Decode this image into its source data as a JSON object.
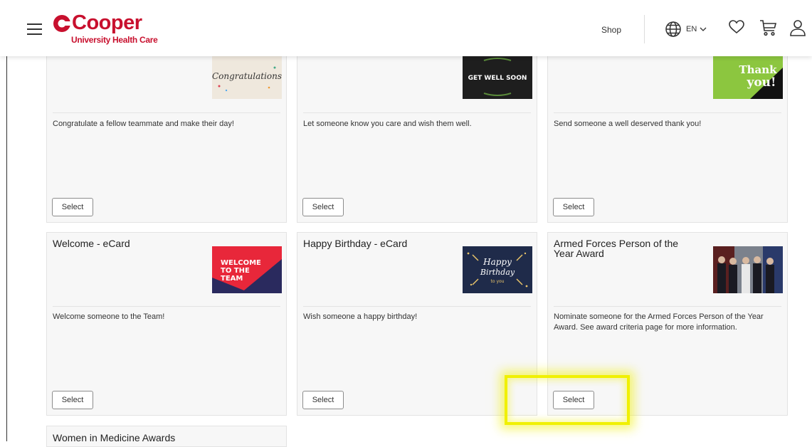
{
  "header": {
    "logo_word": "Cooper",
    "logo_sub": "University Health Care",
    "shop_label": "Shop",
    "lang_label": "EN"
  },
  "colors": {
    "brand": "#c8102e",
    "highlight": "#f0f000"
  },
  "cards": [
    {
      "title": "",
      "description": "Congratulate a fellow teammate and make their day!",
      "button": "Select",
      "image_text": "Congratulations"
    },
    {
      "title": "",
      "description": "Let someone know you care and wish them well.",
      "button": "Select",
      "image_text": "GET WELL SOON"
    },
    {
      "title": "",
      "description": "Send someone a well deserved thank you!",
      "button": "Select",
      "image_text_1": "Thank",
      "image_text_2": "you!"
    },
    {
      "title": "Welcome - eCard",
      "description": "Welcome someone to the Team!",
      "button": "Select",
      "image_text_1": "WELCOME",
      "image_text_2": "TO THE",
      "image_text_3": "TEAM"
    },
    {
      "title": "Happy Birthday - eCard",
      "description": "Wish someone a happy birthday!",
      "button": "Select",
      "image_text_1": "Happy",
      "image_text_2": "Birthday",
      "image_text_3": "to you"
    },
    {
      "title": "Armed Forces Person of the Year Award",
      "description": "Nominate someone for the Armed Forces Person of the Year Award. See award criteria page for more information.",
      "button": "Select"
    },
    {
      "title": "Women in Medicine Awards"
    }
  ],
  "icons": {
    "menu": "hamburger-menu-icon",
    "language": "globe-icon",
    "wishlist": "heart-icon",
    "cart": "cart-icon",
    "account": "user-icon"
  }
}
